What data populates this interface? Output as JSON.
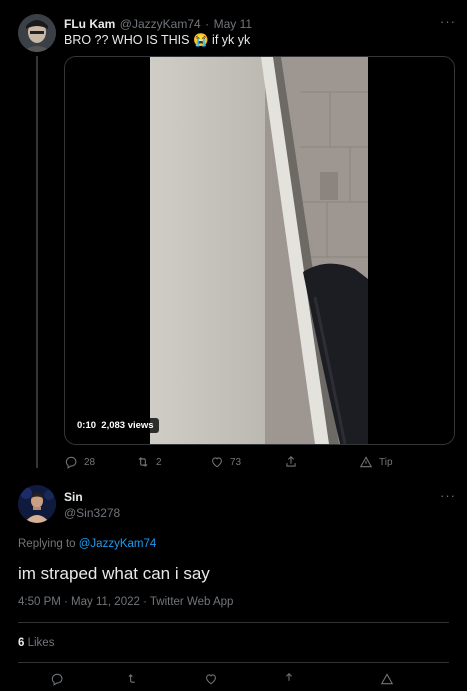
{
  "tweet": {
    "display_name": "FLu Kam",
    "handle": "@JazzyKam74",
    "separator": "·",
    "date": "May 11",
    "text_before": "BRO ?? WHO IS THIS",
    "emoji": "😭",
    "text_after": "if yk yk",
    "video": {
      "time": "0:10",
      "views": "2,083 views"
    },
    "actions": {
      "replies": "28",
      "retweets": "2",
      "likes": "73",
      "tip": "Tip"
    }
  },
  "reply": {
    "display_name": "Sin",
    "handle": "@Sin3278",
    "replying_label": "Replying to",
    "replying_handle": "@JazzyKam74",
    "text": "im straped what can i say",
    "meta": "4:50 PM · May 11, 2022 · Twitter Web App",
    "likes_count": "6",
    "likes_label": "Likes"
  },
  "colors": {
    "link": "#1d9bf0",
    "muted": "#71767b",
    "text": "#e7e9ea",
    "border": "#2f3336"
  }
}
